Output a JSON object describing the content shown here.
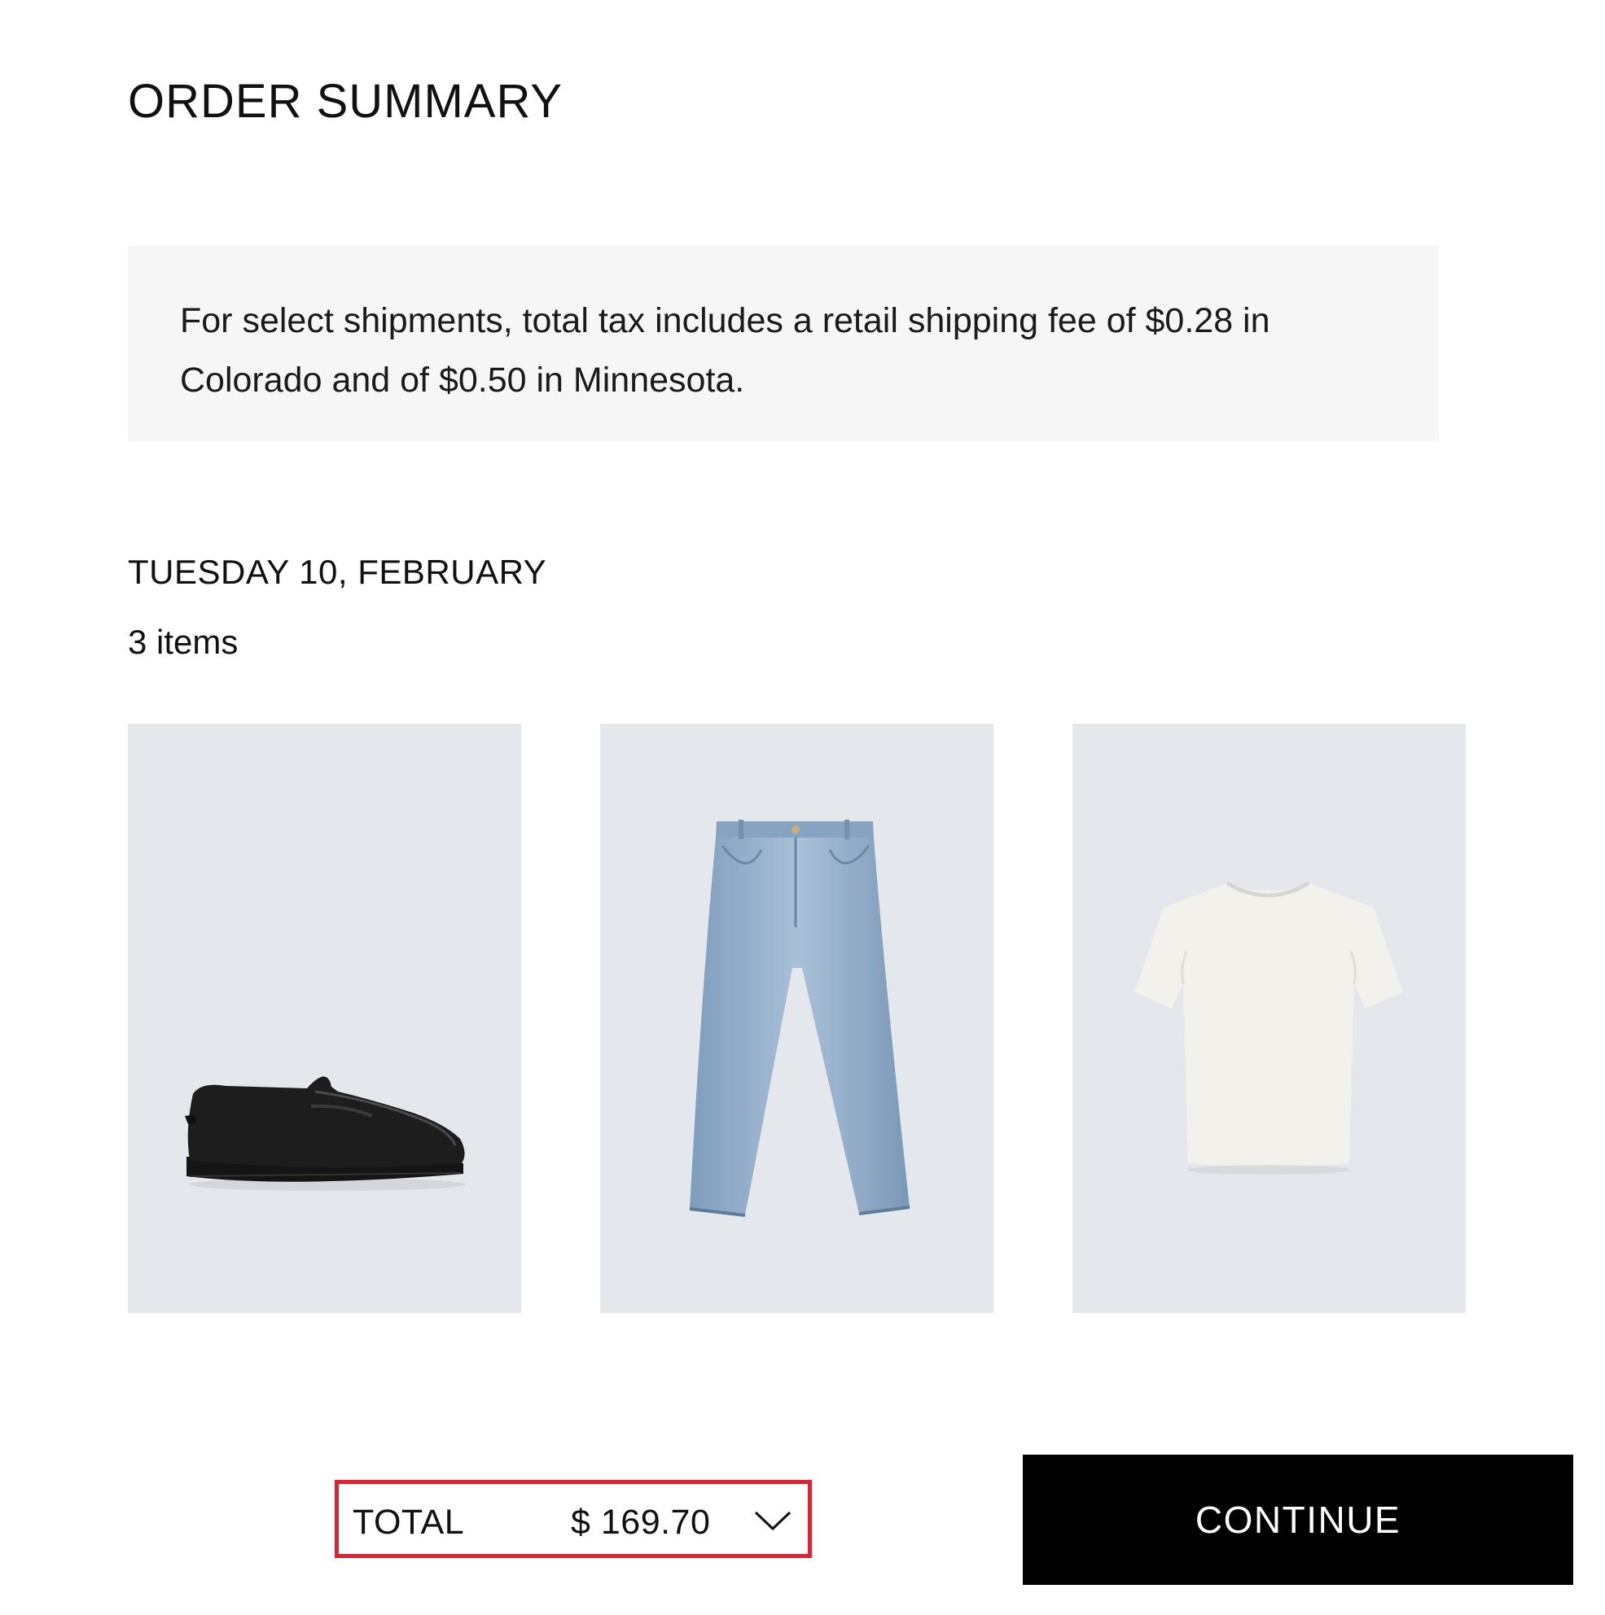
{
  "header": {
    "title": "ORDER SUMMARY"
  },
  "notice": {
    "text": "For select shipments, total tax includes a retail shipping fee of $0.28 in Colorado and of $0.50 in Minnesota."
  },
  "shipment": {
    "date": "TUESDAY 10, FEBRUARY",
    "item_count": "3 items",
    "items": [
      {
        "icon": "loafer-image"
      },
      {
        "icon": "jeans-image"
      },
      {
        "icon": "tshirt-image"
      }
    ]
  },
  "footer": {
    "total_label": "TOTAL",
    "total_value": "$ 169.70",
    "expand_icon": "chevron-down-icon",
    "continue_label": "CONTINUE",
    "highlight_color": "#e3202e"
  }
}
